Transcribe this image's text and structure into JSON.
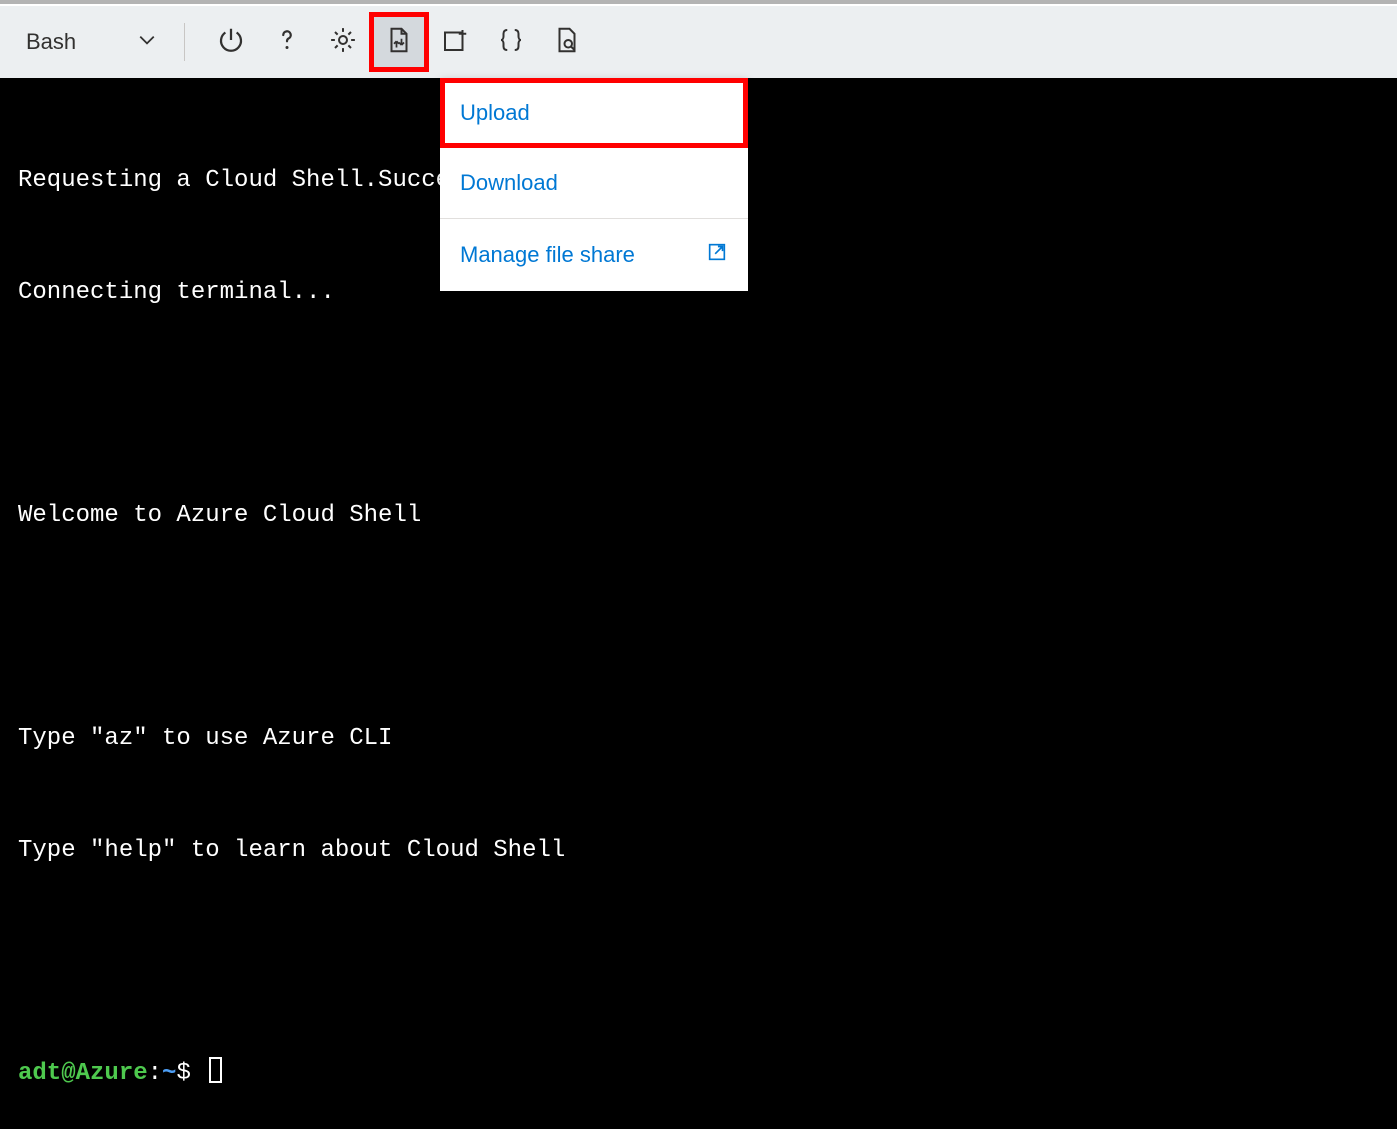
{
  "toolbar": {
    "shell_selector": "Bash",
    "icons": {
      "power": "power-icon",
      "help": "help-icon",
      "settings": "settings-icon",
      "files": "file-updown-icon",
      "newsession": "new-session-icon",
      "editor": "braces-icon",
      "preview": "preview-icon"
    }
  },
  "dropdown": {
    "upload": "Upload",
    "download": "Download",
    "manage": "Manage file share"
  },
  "terminal": {
    "line1": "Requesting a Cloud Shell.Succeeded.",
    "line2": "Connecting terminal...",
    "line3": "Welcome to Azure Cloud Shell",
    "line4": "Type \"az\" to use Azure CLI",
    "line5": "Type \"help\" to learn about Cloud Shell",
    "prompt_user": "adt@Azure",
    "prompt_colon": ":",
    "prompt_path": "~",
    "prompt_dollar": "$"
  }
}
